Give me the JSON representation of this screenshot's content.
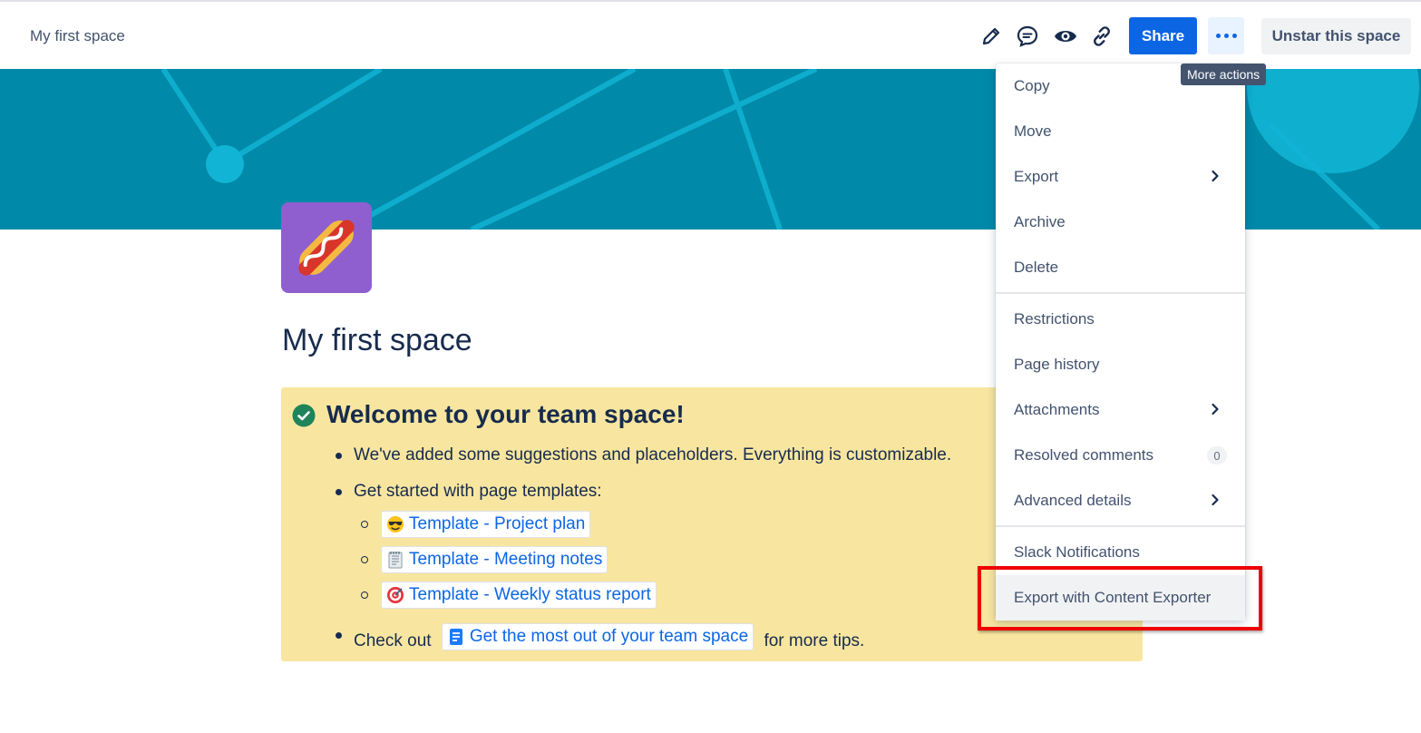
{
  "header": {
    "breadcrumb": "My first space",
    "share_label": "Share",
    "unstar_label": "Unstar this space",
    "tooltip": "More actions",
    "icons": [
      "edit-icon",
      "comment-icon",
      "watch-icon",
      "link-icon",
      "more-icon"
    ]
  },
  "colors": {
    "accent": "#0c66e4",
    "banner": "#0089a8",
    "panel": "#f8e6a0",
    "highlight_box": "#ee0000"
  },
  "page": {
    "title": "My first space",
    "panel_title": "Welcome to your team space!",
    "bullets": {
      "b1": "We've added some suggestions and placeholders. Everything is customizable.",
      "b2": "Get started with page templates:",
      "b3_prefix": "Check out",
      "b3_link": "Get the most out of your team space",
      "b3_suffix": "for more tips."
    },
    "templates": [
      {
        "label": "Template - Project plan",
        "icon": "sunglasses-emoji"
      },
      {
        "label": "Template - Meeting notes",
        "icon": "notepad-emoji"
      },
      {
        "label": "Template - Weekly status report",
        "icon": "target-emoji"
      }
    ]
  },
  "menu": {
    "items": [
      {
        "label": "Copy"
      },
      {
        "label": "Move"
      },
      {
        "label": "Export",
        "submenu": true
      },
      {
        "label": "Archive"
      },
      {
        "label": "Delete"
      },
      {
        "label": "Restrictions"
      },
      {
        "label": "Page history"
      },
      {
        "label": "Attachments",
        "submenu": true
      },
      {
        "label": "Resolved comments",
        "count": "0"
      },
      {
        "label": "Advanced details",
        "submenu": true
      },
      {
        "label": "Slack Notifications"
      },
      {
        "label": "Export with Content Exporter",
        "highlighted": true
      }
    ]
  }
}
